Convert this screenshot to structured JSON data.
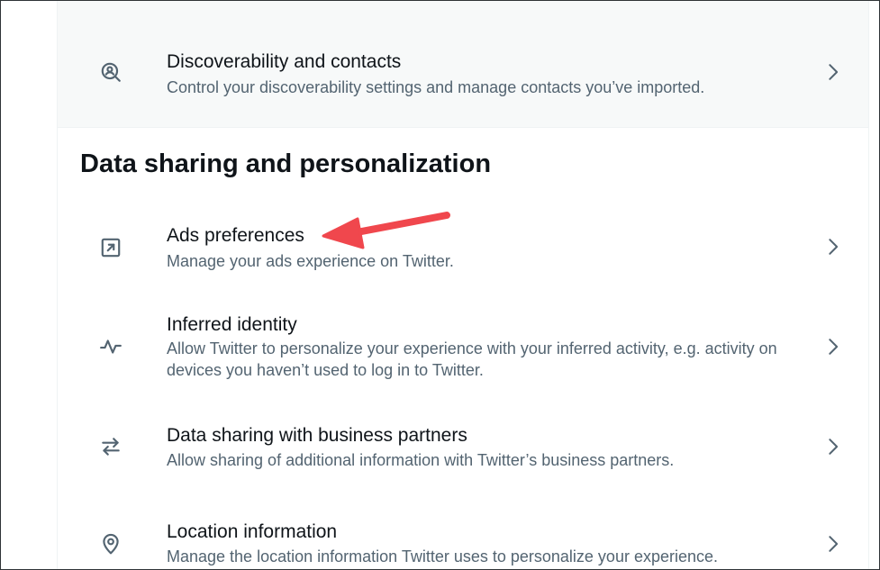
{
  "colors": {
    "primary_text": "#0f1419",
    "secondary_text": "#536471",
    "arrow": "#f0474d",
    "divider": "#eff3f4"
  },
  "top_item": {
    "title": "Discoverability and contacts",
    "description": "Control your discoverability settings and manage contacts you’ve imported.",
    "icon": "search-person-icon"
  },
  "section": {
    "title": "Data sharing and personalization"
  },
  "items": [
    {
      "title": "Ads preferences",
      "description": "Manage your ads experience on Twitter.",
      "icon": "external-box-arrow-icon"
    },
    {
      "title": "Inferred identity",
      "description": "Allow Twitter to personalize your experience with your inferred activity, e.g. activity on devices you haven’t used to log in to Twitter.",
      "icon": "activity-pulse-icon"
    },
    {
      "title": "Data sharing with business partners",
      "description": "Allow sharing of additional information with Twitter’s business partners.",
      "icon": "swap-arrows-icon"
    },
    {
      "title": "Location information",
      "description": "Manage the location information Twitter uses to personalize your experience.",
      "icon": "location-pin-icon"
    }
  ]
}
